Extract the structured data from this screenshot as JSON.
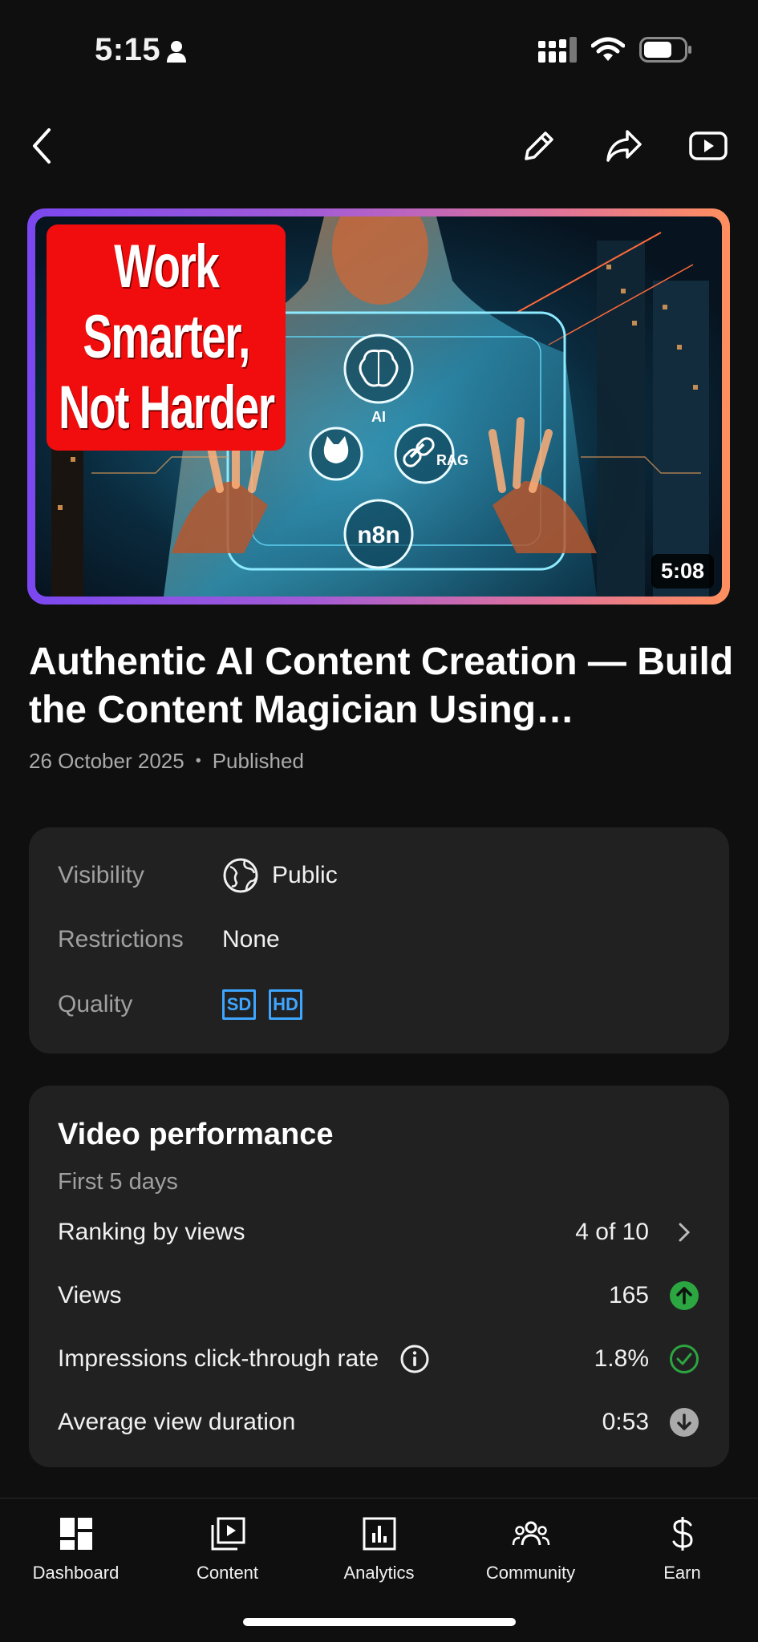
{
  "status_bar": {
    "time": "5:15",
    "icons": [
      "person-icon",
      "cellular-signal-icon",
      "wifi-icon",
      "battery-icon"
    ]
  },
  "app_bar": {
    "icons": [
      "back-icon",
      "edit-pencil-icon",
      "share-icon",
      "youtube-play-icon"
    ]
  },
  "video": {
    "thumbnail_text": [
      "Work",
      "Smarter,",
      "Not Harder"
    ],
    "thumbnail_labels": [
      "AI",
      "RAG",
      "n8n"
    ],
    "duration": "5:08",
    "title": "Authentic AI Content Creation — Build the Content Magician Using…",
    "date": "26 October 2025",
    "separator": "•",
    "status": "Published"
  },
  "details": {
    "visibility_label": "Visibility",
    "visibility_value": "Public",
    "restrictions_label": "Restrictions",
    "restrictions_value": "None",
    "quality_label": "Quality",
    "quality_badges": [
      "SD",
      "HD"
    ]
  },
  "performance": {
    "title": "Video performance",
    "subtitle": "First 5 days",
    "rows": [
      {
        "label": "Ranking by views",
        "value": "4 of 10",
        "icon": "chevron-right-icon"
      },
      {
        "label": "Views",
        "value": "165",
        "icon": "arrow-up-circle-icon"
      },
      {
        "label": "Impressions click-through rate",
        "value": "1.8%",
        "icon": "check-circle-icon"
      },
      {
        "label": "Average view duration",
        "value": "0:53",
        "icon": "arrow-down-circle-icon"
      }
    ],
    "colors": {
      "good": "#2ba640",
      "neutral": "#aaaaaa"
    }
  },
  "bottom_nav": {
    "items": [
      {
        "label": "Dashboard",
        "icon": "dashboard-icon"
      },
      {
        "label": "Content",
        "icon": "content-icon"
      },
      {
        "label": "Analytics",
        "icon": "analytics-icon"
      },
      {
        "label": "Community",
        "icon": "community-icon"
      },
      {
        "label": "Earn",
        "icon": "dollar-icon"
      }
    ]
  },
  "colors": {
    "background": "#0f0f0f",
    "card": "#212121",
    "accent_blue": "#3ea6ff",
    "thumbnail_badge": "#f10d0d"
  }
}
